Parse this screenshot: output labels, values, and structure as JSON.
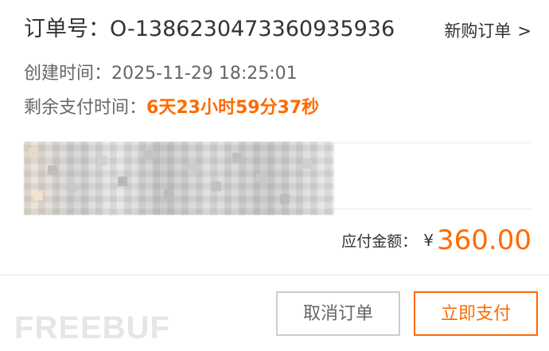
{
  "order": {
    "order_no_label": "订单号：O-1386230473360935936",
    "new_order_link": "新购订单",
    "new_order_chevron": ">",
    "created_label": "创建时间：",
    "created_time": "2025-11-29 18:25:01",
    "remaining_label": "剩余支付时间：",
    "remaining_countdown": "6天23小时59分37秒"
  },
  "product": {
    "image_icon": "blurred-product-icon"
  },
  "summary": {
    "total_label": "应付金额：",
    "currency_symbol": "¥",
    "total_amount": "360.00"
  },
  "actions": {
    "cancel_label": "取消订单",
    "pay_label": "立即支付"
  },
  "watermark": {
    "text": "FREEBUF"
  },
  "colors": {
    "accent": "#ff6a00",
    "text": "#333333",
    "muted": "#666666",
    "border": "#cccccc"
  }
}
